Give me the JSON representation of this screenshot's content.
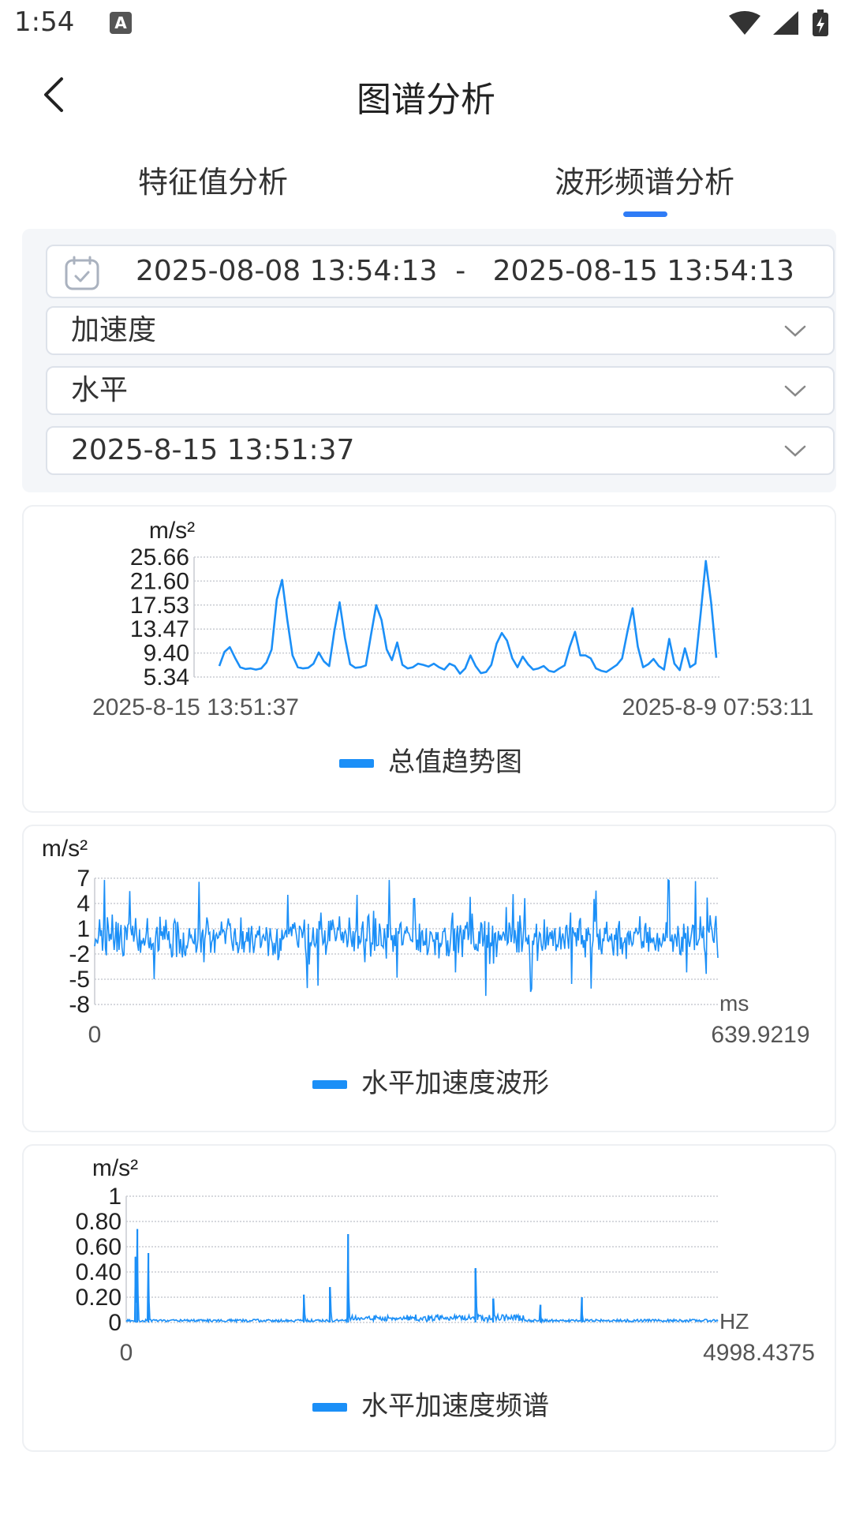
{
  "status": {
    "time": "1:54",
    "badge": "A"
  },
  "header": {
    "title": "图谱分析"
  },
  "tabs": [
    {
      "label": "特征值分析"
    },
    {
      "label": "波形频谱分析"
    }
  ],
  "filters": {
    "date_start": "2025-08-08 13:54:13",
    "date_sep": "-",
    "date_end": "2025-08-15 13:54:13",
    "measure": "加速度",
    "direction": "水平",
    "sample_time": "2025-8-15 13:51:37"
  },
  "colors": {
    "series": "#1b8ff7",
    "accent": "#2f7cf6",
    "panel": "#f4f6f9"
  },
  "chart_data": [
    {
      "type": "line",
      "title": "",
      "unit": "m/s²",
      "legend": "总值趋势图",
      "yticks": [
        "25.66",
        "21.60",
        "17.53",
        "13.47",
        "9.40",
        "5.34"
      ],
      "ylim": [
        5.34,
        25.66
      ],
      "xlabels": [
        "2025-8-15 13:51:37",
        "2025-8-9 07:53:11"
      ],
      "values": [
        7.2,
        9.6,
        10.4,
        8.6,
        7.0,
        6.7,
        6.8,
        6.6,
        6.8,
        7.8,
        10.0,
        18.5,
        21.8,
        15.0,
        9.0,
        7.0,
        6.8,
        6.9,
        7.6,
        9.5,
        8.0,
        7.2,
        13.2,
        18.0,
        12.0,
        7.5,
        6.9,
        7.0,
        7.3,
        12.5,
        17.5,
        15.0,
        10.0,
        8.2,
        11.2,
        7.4,
        6.8,
        7.0,
        7.6,
        7.4,
        7.1,
        7.6,
        7.0,
        6.6,
        7.6,
        7.2,
        5.9,
        6.8,
        9.0,
        7.2,
        6.0,
        6.2,
        7.4,
        11.0,
        12.8,
        11.5,
        8.5,
        7.0,
        8.8,
        7.5,
        6.6,
        6.8,
        7.2,
        6.4,
        6.2,
        6.8,
        7.3,
        10.5,
        13.0,
        9.0,
        9.0,
        8.5,
        6.8,
        6.4,
        6.2,
        6.8,
        7.4,
        8.5,
        13.0,
        17.0,
        10.5,
        7.0,
        7.5,
        8.4,
        7.2,
        6.6,
        11.8,
        7.6,
        6.5,
        10.2,
        7.0,
        7.6,
        16.0,
        25.0,
        18.0,
        8.6
      ]
    },
    {
      "type": "line",
      "title": "",
      "unit": "m/s²",
      "legend": "水平加速度波形",
      "yticks": [
        "7",
        "4",
        "1",
        "-2",
        "-5",
        "-8"
      ],
      "ylim": [
        -8,
        7
      ],
      "xlabels": [
        "0",
        "639.9219"
      ],
      "x_unit": "ms",
      "x_range": [
        0,
        639.9219
      ],
      "signal": "dense random vibration centred near 0, amplitude approx -7.6 to 6.8, 640 samples"
    },
    {
      "type": "line",
      "title": "",
      "unit": "m/s²",
      "legend": "水平加速度频谱",
      "yticks": [
        "1",
        "0.80",
        "0.60",
        "0.40",
        "0.20",
        "0"
      ],
      "ylim": [
        0,
        1
      ],
      "xlabels": [
        "0",
        "4998.4375"
      ],
      "x_unit": "HZ",
      "x_range": [
        0,
        4998.4375
      ],
      "peaks": [
        {
          "x": 78,
          "y": 0.52
        },
        {
          "x": 94,
          "y": 0.74
        },
        {
          "x": 187,
          "y": 0.55
        },
        {
          "x": 1500,
          "y": 0.22
        },
        {
          "x": 1720,
          "y": 0.28
        },
        {
          "x": 1875,
          "y": 0.7
        },
        {
          "x": 2950,
          "y": 0.43
        },
        {
          "x": 3100,
          "y": 0.19
        },
        {
          "x": 3500,
          "y": 0.14
        },
        {
          "x": 3850,
          "y": 0.2
        }
      ]
    }
  ]
}
